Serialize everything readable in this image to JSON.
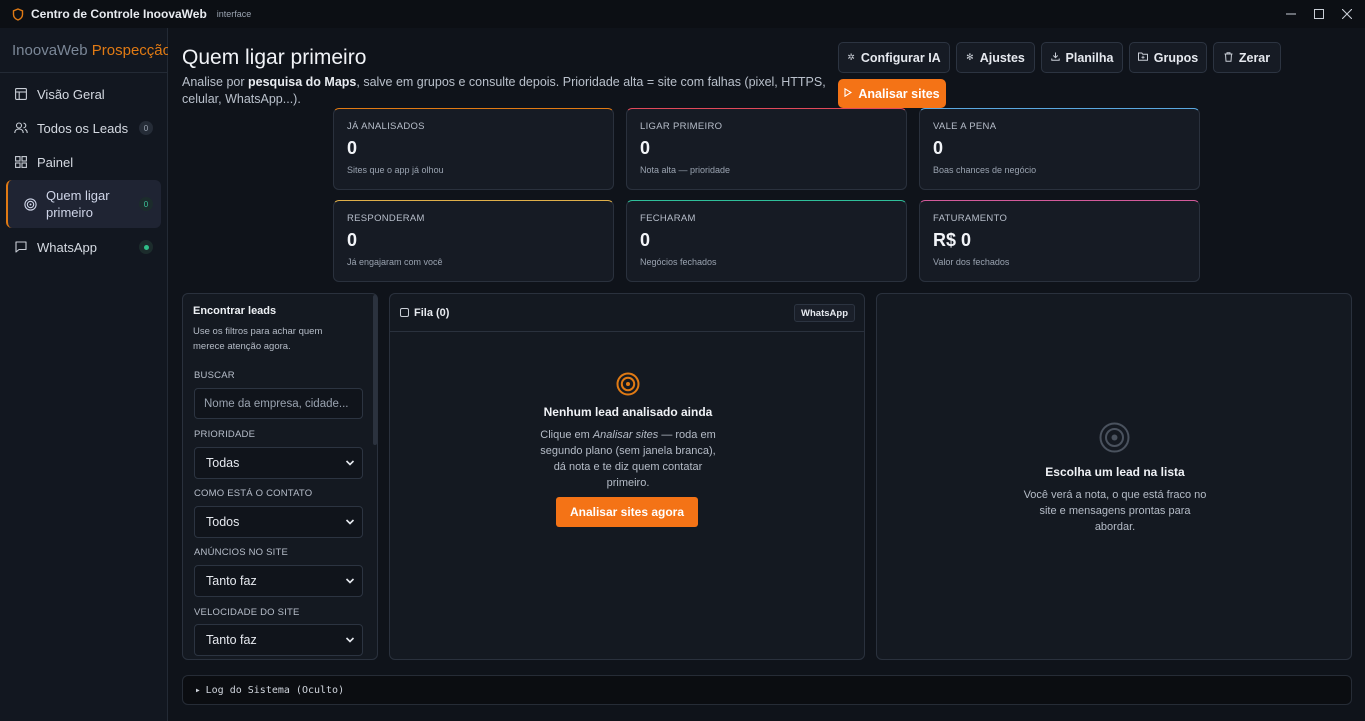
{
  "window": {
    "title": "Centro de Controle InoovaWeb",
    "subtitle": "interface",
    "controls": [
      "minimize",
      "maximize",
      "close"
    ]
  },
  "sidebar": {
    "brand_part1": "InoovaWeb ",
    "brand_part2": "Prospecção",
    "items": [
      {
        "label": "Visão Geral",
        "icon": "layout-icon"
      },
      {
        "label": "Todos os Leads",
        "icon": "users-icon",
        "badge": "0"
      },
      {
        "label": "Painel",
        "icon": "grid-icon"
      },
      {
        "label": "Quem ligar primeiro",
        "icon": "target-icon",
        "badge": "0",
        "active": true
      },
      {
        "label": "WhatsApp",
        "icon": "chat-icon",
        "status": "online"
      }
    ]
  },
  "header": {
    "title": "Quem ligar primeiro",
    "desc_1": "Analise por ",
    "desc_bold": "pesquisa do Maps",
    "desc_2": ", salve em grupos e consulte depois. Prioridade alta = site com falhas (pixel, HTTPS, celular, WhatsApp...)."
  },
  "toolbar": {
    "config_ia": "Configurar IA",
    "ajustes": "Ajustes",
    "planilha": "Planilha",
    "grupos": "Grupos",
    "zerar": "Zerar",
    "analisar": "Analisar sites"
  },
  "stats": [
    {
      "label": "JÁ ANALISADOS",
      "value": "0",
      "note": "Sites que o app já olhou",
      "accent": "#e07a14"
    },
    {
      "label": "LIGAR PRIMEIRO",
      "value": "0",
      "note": "Nota alta — prioridade",
      "accent": "#e0495a"
    },
    {
      "label": "VALE A PENA",
      "value": "0",
      "note": "Boas chances de negócio",
      "accent": "#5aa8e0"
    },
    {
      "label": "RESPONDERAM",
      "value": "0",
      "note": "Já engajaram com você",
      "accent": "#e0b04a"
    },
    {
      "label": "FECHARAM",
      "value": "0",
      "note": "Negócios fechados",
      "accent": "#2fbf9a"
    },
    {
      "label": "FATURAMENTO",
      "value": "R$ 0",
      "note": "Valor dos fechados",
      "accent": "#d25a9a"
    }
  ],
  "filters": {
    "title": "Encontrar leads",
    "help": "Use os filtros para achar quem merece atenção agora.",
    "search_label": "BUSCAR",
    "search_placeholder": "Nome da empresa, cidade...",
    "priority_label": "PRIORIDADE",
    "priority_value": "Todas",
    "contact_label": "COMO ESTÁ O CONTATO",
    "contact_value": "Todos",
    "ads_label": "ANÚNCIOS NO SITE",
    "ads_value": "Tanto faz",
    "speed_label": "VELOCIDADE DO SITE",
    "speed_value": "Tanto faz"
  },
  "queue": {
    "title": "Fila (0)",
    "whatsapp_btn": "WhatsApp",
    "empty_title": "Nenhum lead analisado ainda",
    "empty_text_1": "Clique em ",
    "empty_text_em": "Analisar sites",
    "empty_text_2": " — roda em segundo plano (sem janela branca), dá nota e te diz quem contatar primeiro.",
    "cta": "Analisar sites agora"
  },
  "detail": {
    "empty_title": "Escolha um lead na lista",
    "empty_text": "Você verá a nota, o que está fraco no site e mensagens prontas para abordar."
  },
  "log": {
    "label": "Log do Sistema (Oculto)"
  },
  "colors": {
    "accent": "#f47316",
    "bg": "#0f131a",
    "panel": "#141921"
  }
}
